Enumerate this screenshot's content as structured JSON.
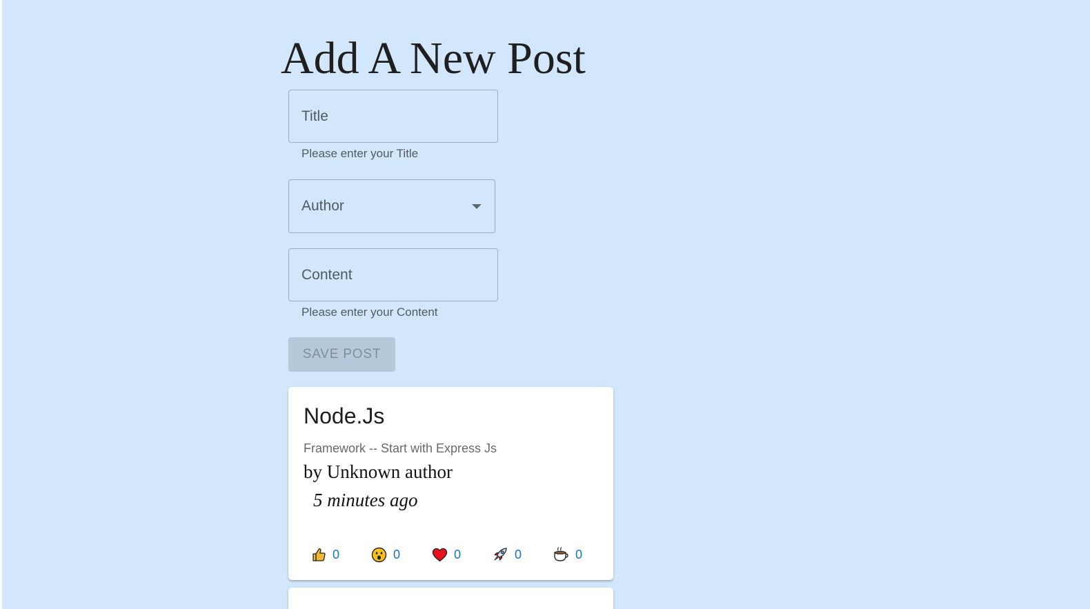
{
  "page": {
    "title": "Add A New Post"
  },
  "form": {
    "title_label": "Title",
    "title_helper": "Please enter your Title",
    "author_label": "Author",
    "content_label": "Content",
    "content_helper": "Please enter your Content",
    "save_label": "SAVE POST",
    "save_disabled": true
  },
  "posts": [
    {
      "title": "Node.Js",
      "excerpt": "Framework -- Start with Express Js",
      "author": "by Unknown author",
      "time": "5 minutes ago",
      "reactions": [
        {
          "icon": "thumbs-up-icon",
          "count": "0"
        },
        {
          "icon": "wow-icon",
          "count": "0"
        },
        {
          "icon": "heart-icon",
          "count": "0"
        },
        {
          "icon": "rocket-icon",
          "count": "0"
        },
        {
          "icon": "coffee-icon",
          "count": "0"
        }
      ]
    }
  ],
  "colors": {
    "page_background": "#d2e7fb",
    "card_background": "#ffffff",
    "reaction_count": "#1b6fd1",
    "disabled_button": "#b6c9da"
  }
}
